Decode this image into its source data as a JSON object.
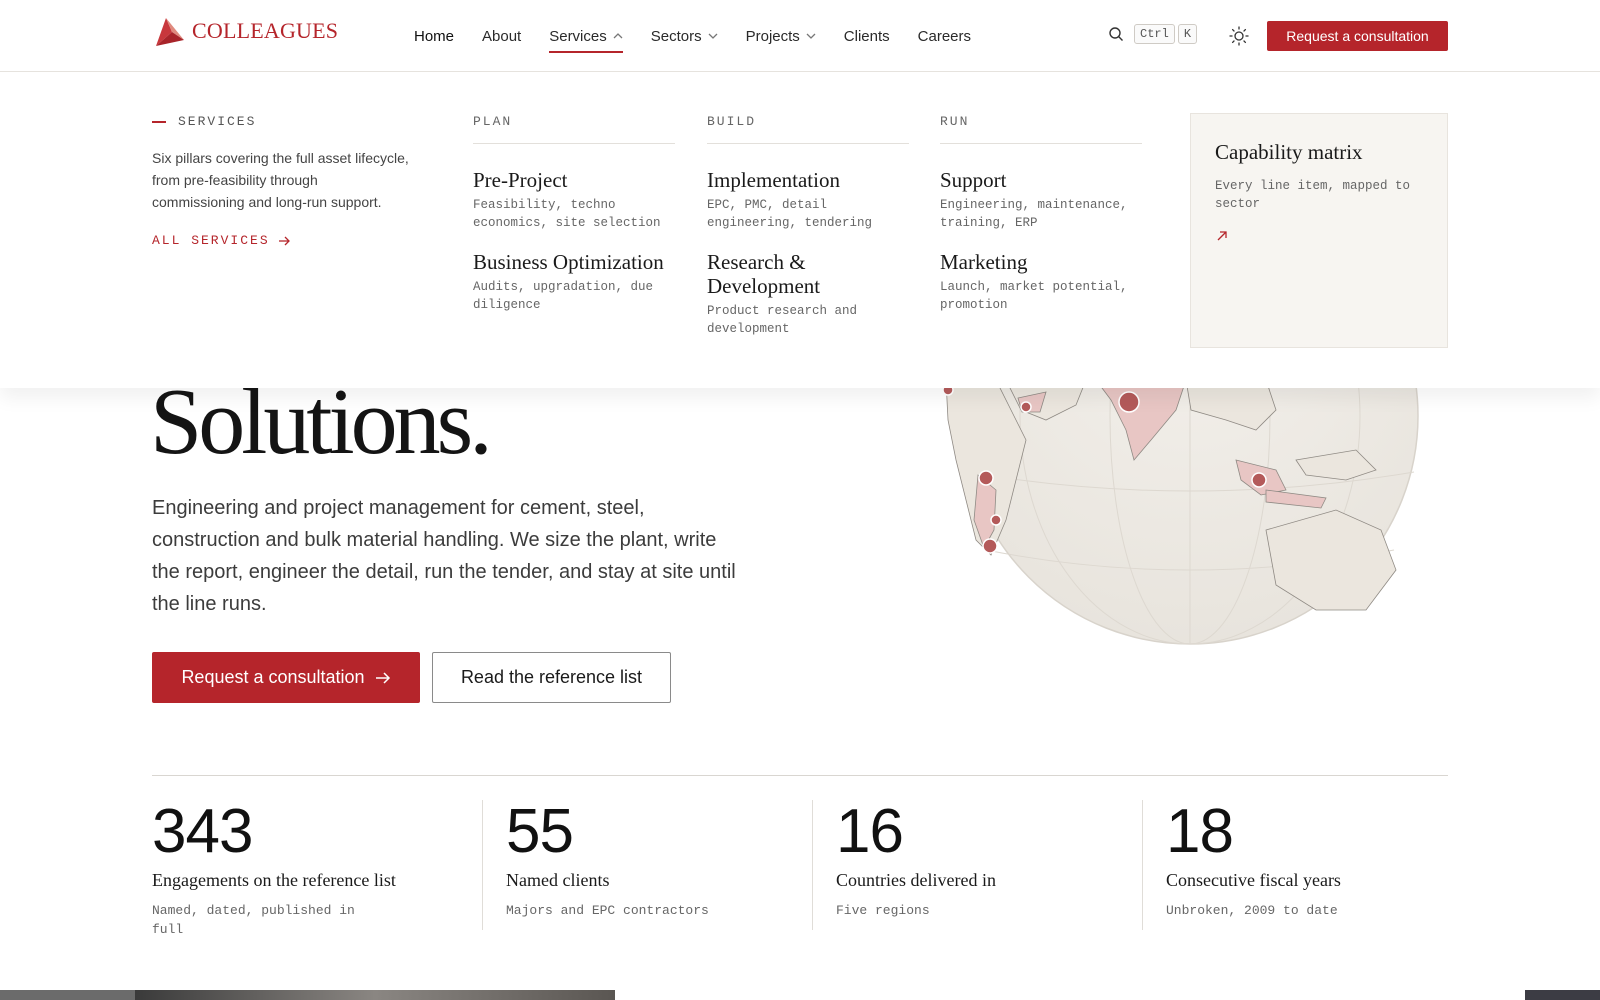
{
  "brand": {
    "name": "COLLEAGUES",
    "accent": "#b5252b"
  },
  "nav": {
    "items": [
      {
        "label": "Home",
        "icon": ""
      },
      {
        "label": "About",
        "icon": ""
      },
      {
        "label": "Services",
        "icon": "chevron-up-icon"
      },
      {
        "label": "Sectors",
        "icon": "chevron-down-icon"
      },
      {
        "label": "Projects",
        "icon": "chevron-down-icon"
      },
      {
        "label": "Clients",
        "icon": ""
      },
      {
        "label": "Careers",
        "icon": ""
      }
    ],
    "active": "Services",
    "search_kbd_1": "Ctrl",
    "search_kbd_2": "K",
    "cta": "Request a consultation"
  },
  "mega": {
    "eyebrow": "SERVICES",
    "description": "Six pillars covering the full asset lifecycle, from pre-feasibility through commissioning and long-run support.",
    "all_link": "ALL SERVICES",
    "columns": [
      {
        "heading": "PLAN",
        "services": [
          {
            "title": "Pre-Project",
            "desc": "Feasibility, techno economics, site selection"
          },
          {
            "title": "Business Optimization",
            "desc": "Audits, upgradation, due diligence"
          }
        ]
      },
      {
        "heading": "BUILD",
        "services": [
          {
            "title": "Implementation",
            "desc": "EPC, PMC, detail engineering, tendering"
          },
          {
            "title": "Research & Development",
            "desc": "Product research and development"
          }
        ]
      },
      {
        "heading": "RUN",
        "services": [
          {
            "title": "Support",
            "desc": "Engineering, maintenance, training, ERP"
          },
          {
            "title": "Marketing",
            "desc": "Launch, market potential, promotion"
          }
        ]
      }
    ],
    "card": {
      "title": "Capability matrix",
      "desc": "Every line item, mapped to sector"
    }
  },
  "hero": {
    "title": "Solutions.",
    "body": "Engineering and project management for cement, steel, construction and bulk material handling. We size the plant, write the report, engineer the detail, run the tender, and stay at site until the line runs.",
    "primary_cta": "Request a consultation",
    "secondary_cta": "Read the reference list"
  },
  "stats": [
    {
      "value": "343",
      "label": "Engagements on the reference list",
      "sub": "Named, dated, published in full"
    },
    {
      "value": "55",
      "label": "Named clients",
      "sub": "Majors and EPC contractors"
    },
    {
      "value": "16",
      "label": "Countries delivered in",
      "sub": "Five regions"
    },
    {
      "value": "18",
      "label": "Consecutive fiscal years",
      "sub": "Unbroken, 2009 to date"
    }
  ]
}
